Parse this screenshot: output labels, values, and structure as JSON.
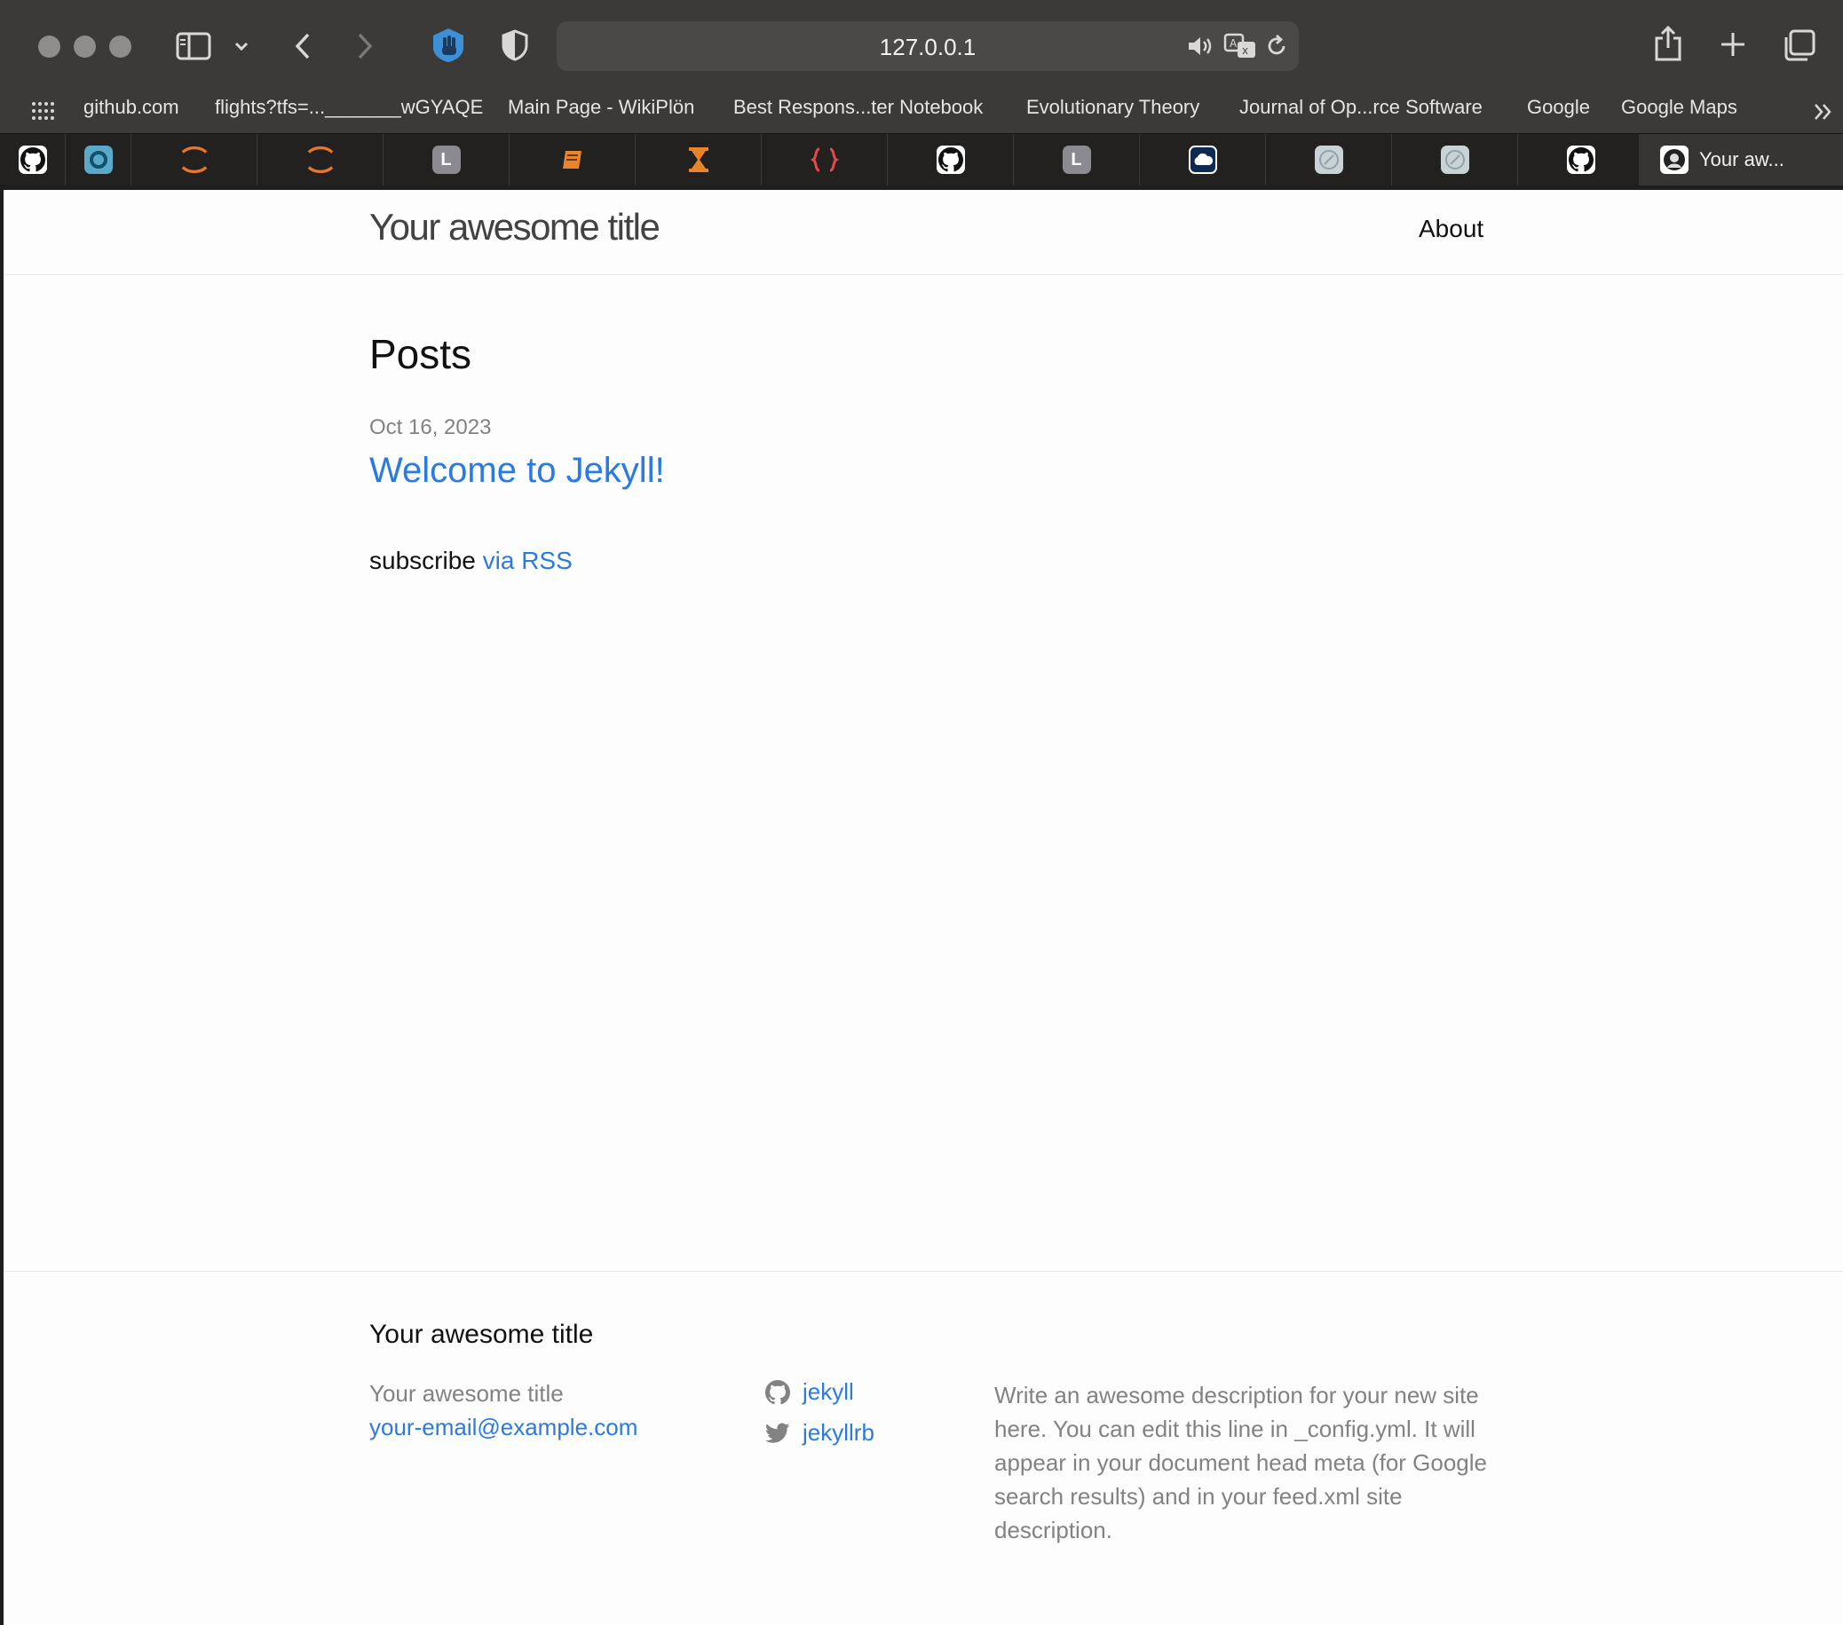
{
  "browser": {
    "url": "127.0.0.1",
    "bookmarks": [
      "github.com",
      "flights?tfs=..._______wGYAQE",
      "Main Page - WikiPlön",
      "Best Respons...ter Notebook",
      "Evolutionary Theory",
      "Journal of Op...rce Software",
      "Google",
      "Google Maps"
    ],
    "active_tab_title": "Your aw...",
    "tab_letter": "L"
  },
  "site": {
    "title": "Your awesome title",
    "nav_about": "About"
  },
  "main": {
    "heading": "Posts",
    "post": {
      "date": "Oct 16, 2023",
      "title": "Welcome to Jekyll!"
    },
    "subscribe_text": "subscribe",
    "rss_link": "via RSS"
  },
  "footer": {
    "heading": "Your awesome title",
    "name": "Your awesome title",
    "email": "your-email@example.com",
    "github": "jekyll",
    "twitter": "jekyllrb",
    "description": "Write an awesome description for your new site here. You can edit this line in _config.yml. It will appear in your document head meta (for Google search results) and in your feed.xml site description."
  },
  "colors": {
    "link": "#2a7ae2",
    "muted": "#828282",
    "chrome": "#3b3a39"
  }
}
